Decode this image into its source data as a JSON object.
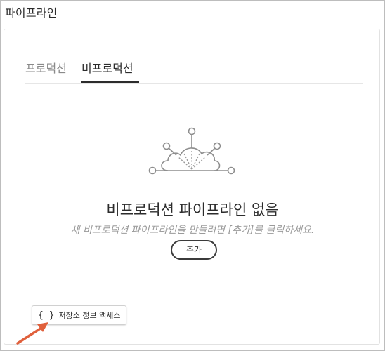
{
  "window": {
    "title": "파이프라인"
  },
  "tabs": [
    {
      "label": "프로덕션",
      "active": false
    },
    {
      "label": "비프로덕션",
      "active": true
    }
  ],
  "empty_state": {
    "icon": "cloud-network-icon",
    "title": "비프로덕션 파이프라인 없음",
    "description": "새 비프로덕션 파이프라인을 만들려면 [추가]를 클릭하세요.",
    "add_label": "추가"
  },
  "repo_access": {
    "icon": "braces-icon",
    "braces": "{ }",
    "label": "저장소 정보 액세스"
  },
  "annotation": {
    "icon": "red-arrow-icon",
    "color": "#e0603c"
  },
  "colors": {
    "text": "#2c2c2c",
    "muted": "#9a9a9a",
    "border": "#e2e2e2"
  }
}
